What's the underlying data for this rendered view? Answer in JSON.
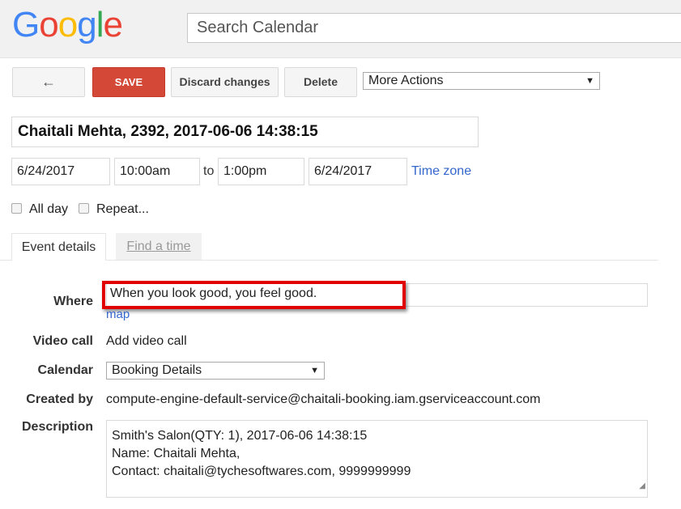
{
  "header": {
    "logo": [
      "G",
      "o",
      "o",
      "g",
      "l",
      "e"
    ],
    "logo_colors": [
      "#4285f4",
      "#ea4335",
      "#fbbc05",
      "#4285f4",
      "#34a853",
      "#ea4335"
    ],
    "search_placeholder": "Search Calendar"
  },
  "toolbar": {
    "back_icon": "←",
    "save_label": "SAVE",
    "discard_label": "Discard changes",
    "delete_label": "Delete",
    "more_actions": "More Actions",
    "dropdown_arrow": "▼"
  },
  "event": {
    "title": "Chaitali Mehta, 2392, 2017-06-06 14:38:15",
    "start_date": "6/24/2017",
    "start_time": "10:00am",
    "to_label": "to",
    "end_time": "1:00pm",
    "end_date": "6/24/2017",
    "time_zone_link": "Time zone",
    "all_day_label": "All day",
    "repeat_label": "Repeat..."
  },
  "tabs": [
    {
      "label": "Event details",
      "active": true
    },
    {
      "label": "Find a time",
      "active": false
    }
  ],
  "details": {
    "where_label": "Where",
    "where_value": "When you look good, you feel good.",
    "map_link": "map",
    "video_label": "Video call",
    "video_link": "Add video call",
    "calendar_label": "Calendar",
    "calendar_value": "Booking Details",
    "created_label": "Created by",
    "created_value": "compute-engine-default-service@chaitali-booking.iam.gserviceaccount.com",
    "description_label": "Description",
    "description_lines": [
      "Smith's Salon(QTY: 1), 2017-06-06 14:38:15",
      "Name: Chaitali Mehta,",
      "Contact: chaitali@tychesoftwares.com, 9999999999"
    ]
  },
  "colors": {
    "save_button": "#d44837",
    "link": "#3366cc",
    "highlight_border": "#e00000"
  }
}
